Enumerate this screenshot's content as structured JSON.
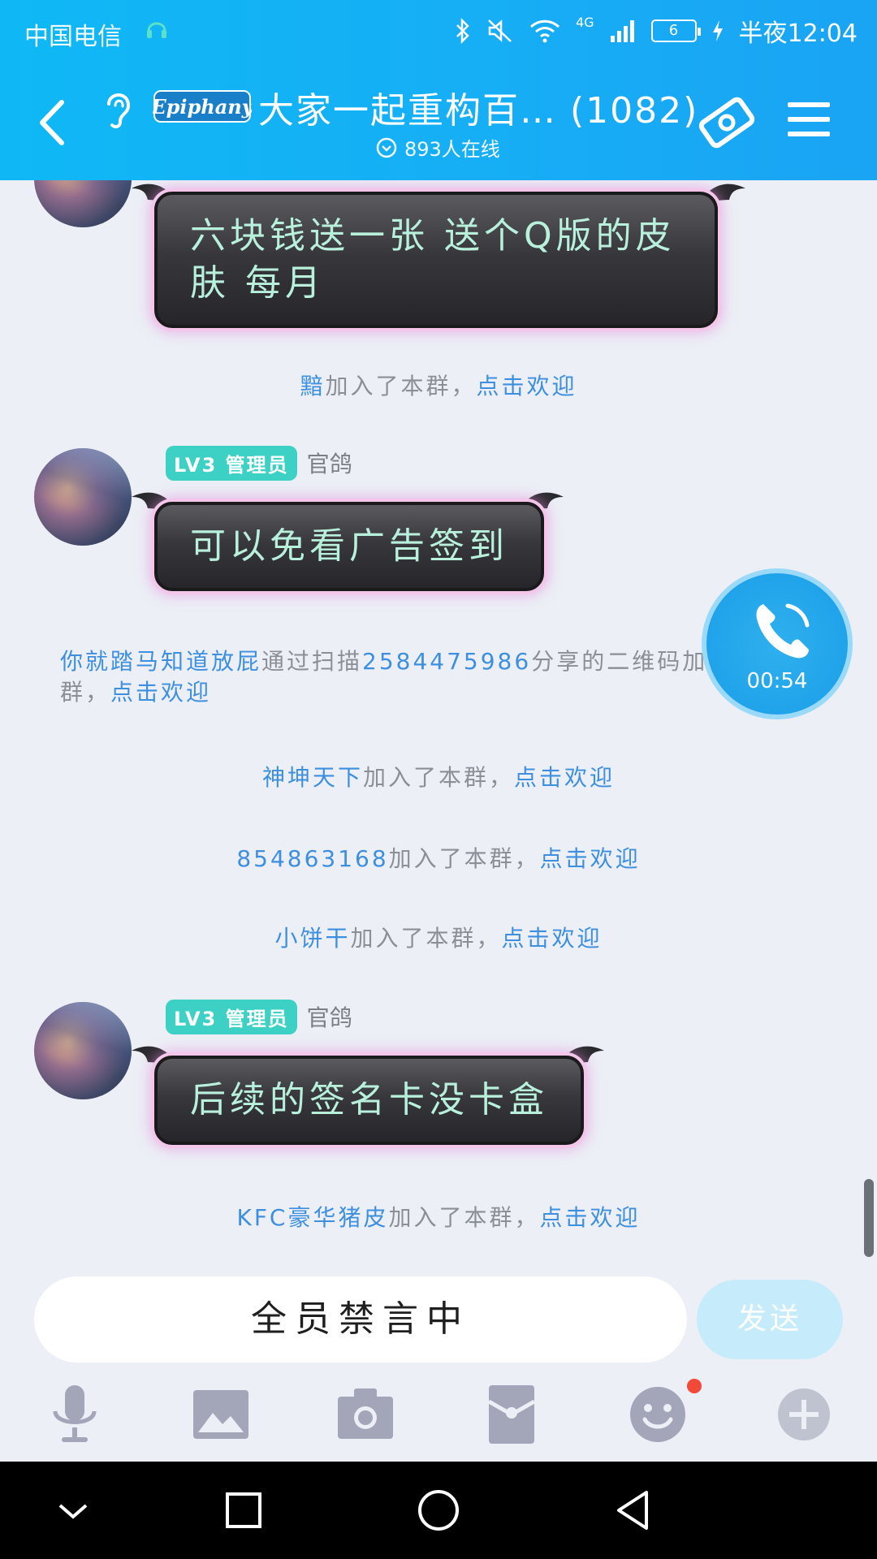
{
  "status_bar": {
    "carrier": "中国电信",
    "time": "半夜12:04",
    "battery": "6",
    "network": "4G"
  },
  "header": {
    "logo_text": "Epiphany",
    "title": "大家一起重构百… (1082)",
    "online": "893人在线"
  },
  "messages": [
    {
      "type": "bubble",
      "text_lines": [
        "六块钱送一张 送个Q版的皮",
        "肤 每月"
      ]
    },
    {
      "type": "system",
      "name": "黯",
      "middle": "加入了本群，",
      "link": "点击欢迎"
    },
    {
      "type": "bubble",
      "badge": "LV3 管理员",
      "nick": "官鸽",
      "text_lines": [
        "可以免看广告签到"
      ]
    },
    {
      "type": "system",
      "name": "你就踏马知道放屁",
      "middle_a": "通过扫描",
      "qq": "2584475986",
      "middle_b": "分享的二维码加入了本群，",
      "link": "点击欢迎"
    },
    {
      "type": "system",
      "name": "神坤天下",
      "middle": "加入了本群，",
      "link": "点击欢迎"
    },
    {
      "type": "system",
      "name": "854863168",
      "middle": "加入了本群，",
      "link": "点击欢迎"
    },
    {
      "type": "system",
      "name": "小饼干",
      "middle": "加入了本群，",
      "link": "点击欢迎"
    },
    {
      "type": "bubble",
      "badge": "LV3 管理员",
      "nick": "官鸽",
      "text_lines": [
        "后续的签名卡没卡盒"
      ]
    },
    {
      "type": "system",
      "name": "KFC豪华猪皮",
      "middle": "加入了本群，",
      "link": "点击欢迎"
    }
  ],
  "call": {
    "duration": "00:54"
  },
  "input": {
    "placeholder": "全员禁言中",
    "send_label": "发送"
  },
  "colors": {
    "header": "#16aef5",
    "link": "#3d8fe0",
    "badge": "#3cd1c4",
    "bubble_text": "#b8f0dc"
  }
}
